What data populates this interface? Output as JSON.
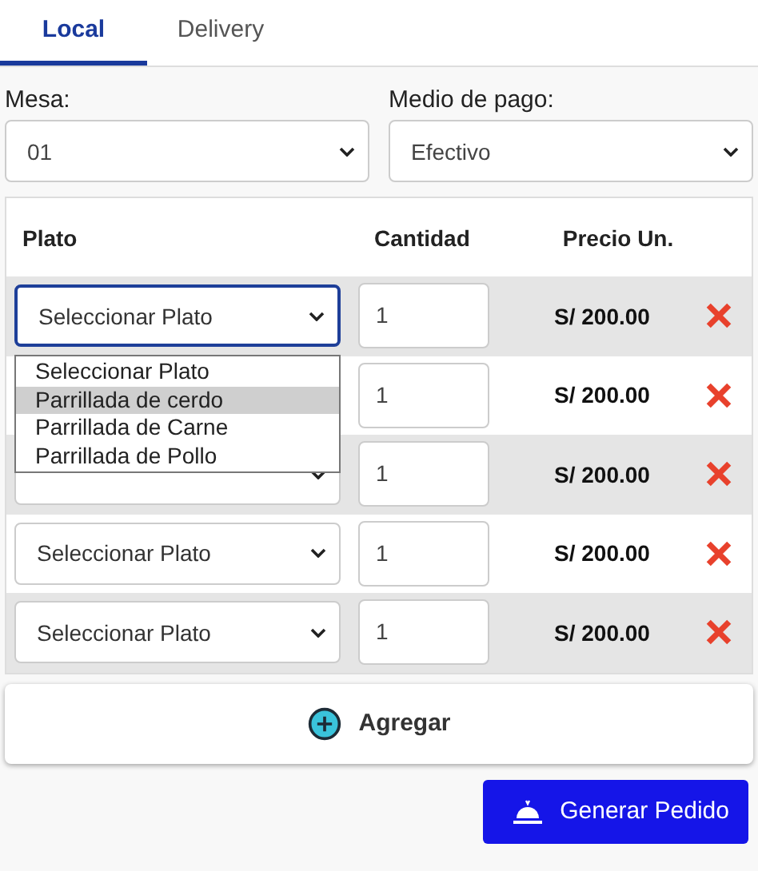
{
  "tabs": [
    {
      "label": "Local",
      "selected": true
    },
    {
      "label": "Delivery",
      "selected": false
    }
  ],
  "fields": [
    {
      "label": "Mesa:",
      "value": "01"
    },
    {
      "label": "Medio de pago:",
      "value": "Efectivo"
    }
  ],
  "table": {
    "columns": [
      "Plato",
      "Cantidad",
      "Precio Un."
    ],
    "rows": [
      {
        "dish": "Seleccionar Plato",
        "focused": true,
        "quantity": "1",
        "price": "S/ 200.00",
        "dropdown": {
          "options": [
            {
              "label": "Seleccionar Plato",
              "selected": false
            },
            {
              "label": "Parrillada de cerdo",
              "selected": true
            },
            {
              "label": "Parrillada de Carne",
              "selected": false
            },
            {
              "label": "Parrillada de Pollo",
              "selected": false
            }
          ]
        }
      },
      {
        "quantity": "1",
        "price": "S/ 200.00"
      },
      {
        "focused": false,
        "quantity": "1",
        "price": "S/ 200.00"
      },
      {
        "dish": "Seleccionar Plato",
        "focused": false,
        "quantity": "1",
        "price": "S/ 200.00"
      },
      {
        "dish": "Seleccionar Plato",
        "focused": false,
        "quantity": "1",
        "price": "S/ 200.00"
      }
    ]
  },
  "add_button": "Agregar",
  "submit_button": "Generar Pedido"
}
